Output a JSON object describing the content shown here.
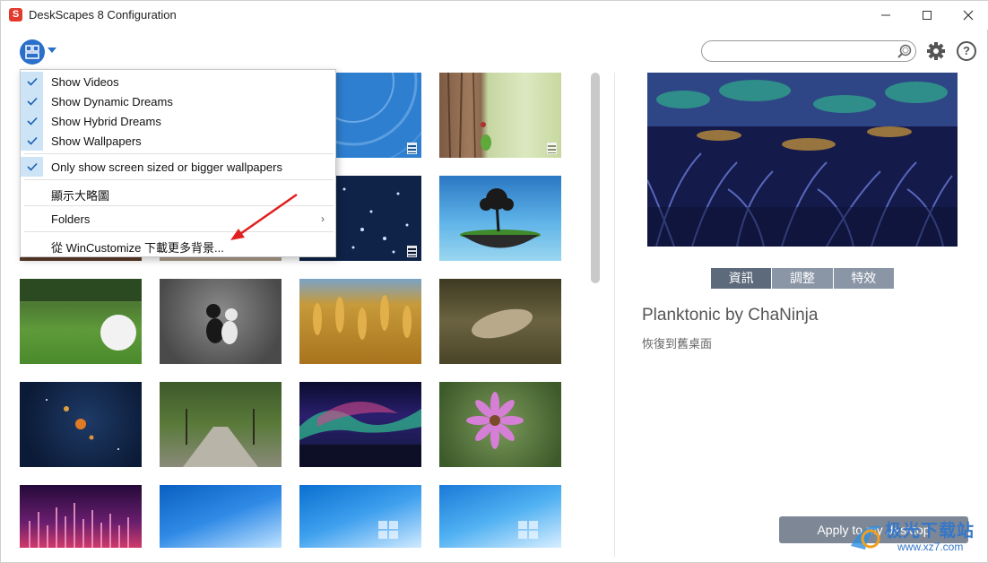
{
  "window": {
    "title": "DeskScapes 8 Configuration",
    "logo_letter": "S"
  },
  "menu": {
    "items": [
      {
        "label": "Show Videos",
        "checked": true
      },
      {
        "label": "Show Dynamic Dreams",
        "checked": true
      },
      {
        "label": "Show Hybrid Dreams",
        "checked": true
      },
      {
        "label": "Show Wallpapers",
        "checked": true
      },
      {
        "label": "Only show screen sized or bigger wallpapers",
        "checked": true
      },
      {
        "label": "顯示大略圖",
        "checked": false
      },
      {
        "label": "Folders",
        "checked": false,
        "has_submenu": true
      },
      {
        "label": "從 WinCustomize 下載更多背景...",
        "checked": false
      }
    ],
    "submenu_glyph": "›"
  },
  "toolbar": {
    "help_glyph": "?"
  },
  "thumbnails": [
    {
      "name": "blue-circles",
      "video": true
    },
    {
      "name": "tree-bark",
      "video": true
    },
    {
      "name": "starfield",
      "video": true
    },
    {
      "name": "floating-island",
      "video": false
    },
    {
      "name": "golf-ball",
      "video": false
    },
    {
      "name": "cats",
      "video": false
    },
    {
      "name": "wheat",
      "video": false
    },
    {
      "name": "leaf-ground",
      "video": false
    },
    {
      "name": "solar-system",
      "video": false
    },
    {
      "name": "tree-road",
      "video": false
    },
    {
      "name": "aurora",
      "video": false
    },
    {
      "name": "pink-flower",
      "video": false
    },
    {
      "name": "sound-bars",
      "video": false
    },
    {
      "name": "windows-blue-1",
      "video": false
    },
    {
      "name": "windows-blue-2",
      "video": false
    },
    {
      "name": "windows-blue-3",
      "video": false
    }
  ],
  "preview": {
    "title": "Planktonic by ChaNinja",
    "subtitle": "恢復到舊桌面",
    "tabs": [
      "資訊",
      "調整",
      "特效"
    ],
    "active_tab": 0
  },
  "actions": {
    "apply_label": "Apply to my desktop"
  },
  "watermark": {
    "text": "极光下载站",
    "url": "www.xz7.com"
  },
  "colors": {
    "accent": "#2a6fc9",
    "tab_active": "#5d6a7b",
    "apply": "#7d8796"
  }
}
